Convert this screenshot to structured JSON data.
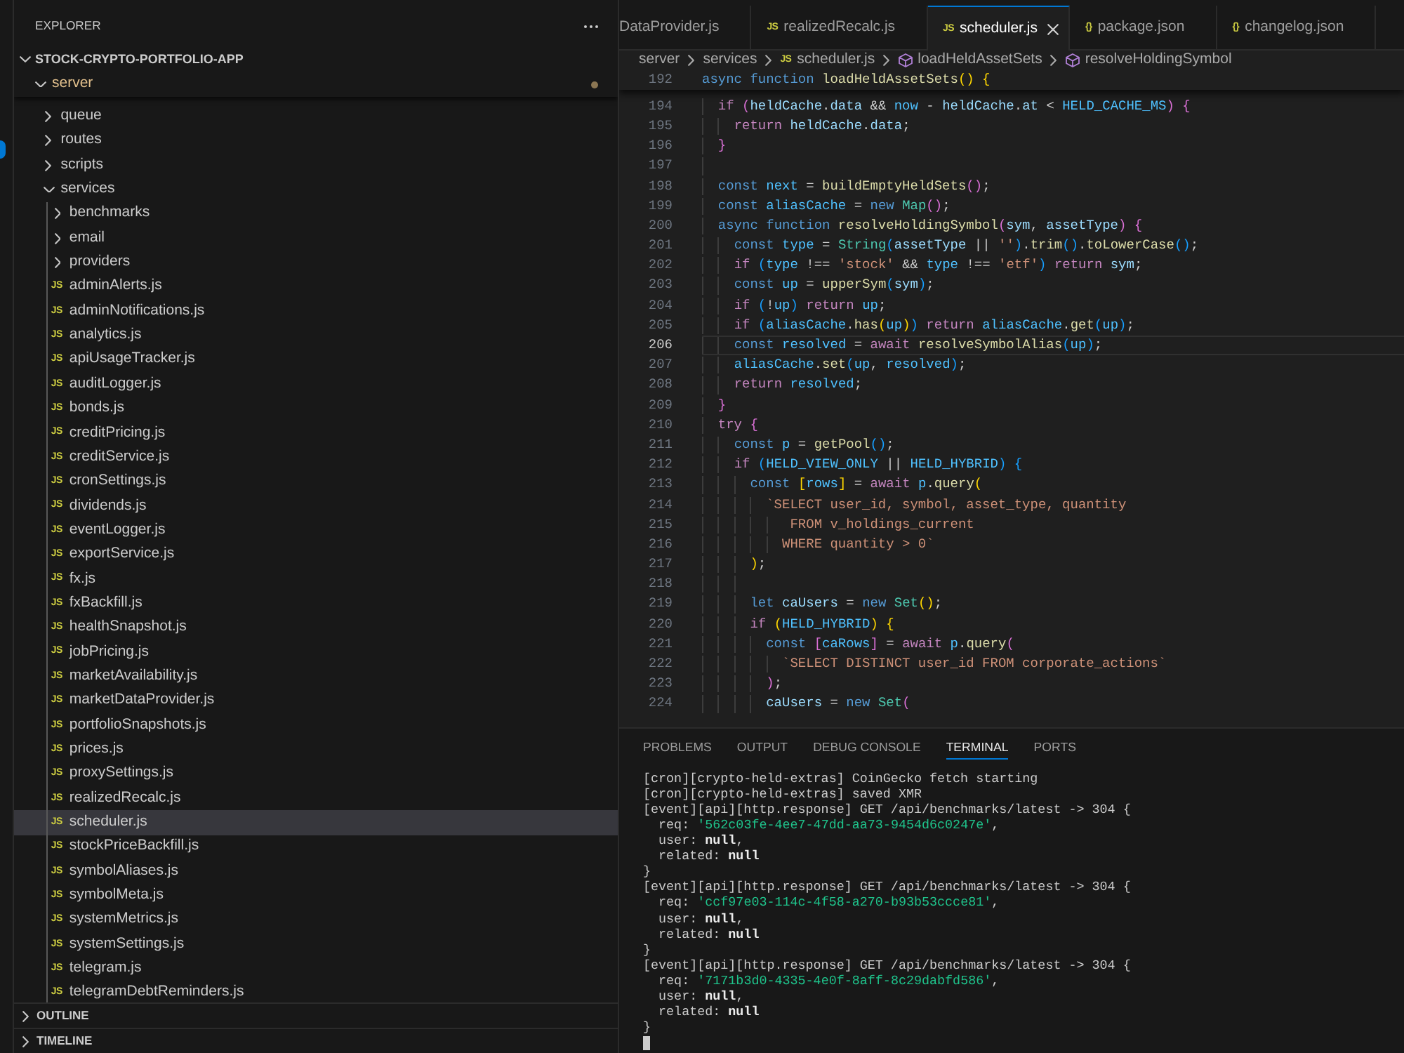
{
  "sidebar": {
    "title": "EXPLORER",
    "root": {
      "label": "STOCK-CRYPTO-PORTFOLIO-APP",
      "expanded": true,
      "children": [
        {
          "label": "server",
          "kind": "folder",
          "expanded": true,
          "modified": true,
          "selected": false,
          "children": [
            {
              "label": "queue",
              "kind": "folder",
              "expanded": false,
              "modified": false,
              "selected": false
            },
            {
              "label": "routes",
              "kind": "folder",
              "expanded": false,
              "modified": false,
              "selected": false
            },
            {
              "label": "scripts",
              "kind": "folder",
              "expanded": false,
              "modified": false,
              "selected": false
            },
            {
              "label": "services",
              "kind": "folder",
              "expanded": true,
              "modified": false,
              "selected": false,
              "children": [
                {
                  "label": "benchmarks",
                  "kind": "folder",
                  "expanded": false,
                  "modified": false,
                  "selected": false
                },
                {
                  "label": "email",
                  "kind": "folder",
                  "expanded": false,
                  "modified": false,
                  "selected": false
                },
                {
                  "label": "providers",
                  "kind": "folder",
                  "expanded": false,
                  "modified": false,
                  "selected": false
                },
                {
                  "label": "adminAlerts.js",
                  "kind": "file",
                  "icon": "JS",
                  "modified": false,
                  "selected": false
                },
                {
                  "label": "adminNotifications.js",
                  "kind": "file",
                  "icon": "JS",
                  "modified": false,
                  "selected": false
                },
                {
                  "label": "analytics.js",
                  "kind": "file",
                  "icon": "JS",
                  "modified": false,
                  "selected": false
                },
                {
                  "label": "apiUsageTracker.js",
                  "kind": "file",
                  "icon": "JS",
                  "modified": false,
                  "selected": false
                },
                {
                  "label": "auditLogger.js",
                  "kind": "file",
                  "icon": "JS",
                  "modified": false,
                  "selected": false
                },
                {
                  "label": "bonds.js",
                  "kind": "file",
                  "icon": "JS",
                  "modified": false,
                  "selected": false
                },
                {
                  "label": "creditPricing.js",
                  "kind": "file",
                  "icon": "JS",
                  "modified": false,
                  "selected": false
                },
                {
                  "label": "creditService.js",
                  "kind": "file",
                  "icon": "JS",
                  "modified": false,
                  "selected": false
                },
                {
                  "label": "cronSettings.js",
                  "kind": "file",
                  "icon": "JS",
                  "modified": false,
                  "selected": false
                },
                {
                  "label": "dividends.js",
                  "kind": "file",
                  "icon": "JS",
                  "modified": false,
                  "selected": false
                },
                {
                  "label": "eventLogger.js",
                  "kind": "file",
                  "icon": "JS",
                  "modified": false,
                  "selected": false
                },
                {
                  "label": "exportService.js",
                  "kind": "file",
                  "icon": "JS",
                  "modified": false,
                  "selected": false
                },
                {
                  "label": "fx.js",
                  "kind": "file",
                  "icon": "JS",
                  "modified": false,
                  "selected": false
                },
                {
                  "label": "fxBackfill.js",
                  "kind": "file",
                  "icon": "JS",
                  "modified": false,
                  "selected": false
                },
                {
                  "label": "healthSnapshot.js",
                  "kind": "file",
                  "icon": "JS",
                  "modified": false,
                  "selected": false
                },
                {
                  "label": "jobPricing.js",
                  "kind": "file",
                  "icon": "JS",
                  "modified": false,
                  "selected": false
                },
                {
                  "label": "marketAvailability.js",
                  "kind": "file",
                  "icon": "JS",
                  "modified": false,
                  "selected": false
                },
                {
                  "label": "marketDataProvider.js",
                  "kind": "file",
                  "icon": "JS",
                  "modified": false,
                  "selected": false
                },
                {
                  "label": "portfolioSnapshots.js",
                  "kind": "file",
                  "icon": "JS",
                  "modified": false,
                  "selected": false
                },
                {
                  "label": "prices.js",
                  "kind": "file",
                  "icon": "JS",
                  "modified": false,
                  "selected": false
                },
                {
                  "label": "proxySettings.js",
                  "kind": "file",
                  "icon": "JS",
                  "modified": false,
                  "selected": false
                },
                {
                  "label": "realizedRecalc.js",
                  "kind": "file",
                  "icon": "JS",
                  "modified": false,
                  "selected": false
                },
                {
                  "label": "scheduler.js",
                  "kind": "file",
                  "icon": "JS",
                  "modified": false,
                  "selected": true
                },
                {
                  "label": "stockPriceBackfill.js",
                  "kind": "file",
                  "icon": "JS",
                  "modified": false,
                  "selected": false
                },
                {
                  "label": "symbolAliases.js",
                  "kind": "file",
                  "icon": "JS",
                  "modified": false,
                  "selected": false
                },
                {
                  "label": "symbolMeta.js",
                  "kind": "file",
                  "icon": "JS",
                  "modified": false,
                  "selected": false
                },
                {
                  "label": "systemMetrics.js",
                  "kind": "file",
                  "icon": "JS",
                  "modified": false,
                  "selected": false
                },
                {
                  "label": "systemSettings.js",
                  "kind": "file",
                  "icon": "JS",
                  "modified": false,
                  "selected": false
                },
                {
                  "label": "telegram.js",
                  "kind": "file",
                  "icon": "JS",
                  "modified": false,
                  "selected": false
                },
                {
                  "label": "telegramDebtReminders.js",
                  "kind": "file",
                  "icon": "JS",
                  "modified": false,
                  "selected": false
                }
              ]
            }
          ]
        }
      ]
    },
    "sections": [
      {
        "label": "OUTLINE",
        "expanded": false
      },
      {
        "label": "TIMELINE",
        "expanded": false
      }
    ]
  },
  "editor": {
    "tabs": [
      {
        "label": "DataProvider.js",
        "selected": false
      },
      {
        "label": "realizedRecalc.js",
        "icon": "JS",
        "selected": false
      },
      {
        "label": "scheduler.js",
        "icon": "JS",
        "selected": true
      },
      {
        "label": "package.json",
        "icon": "{}",
        "selected": false
      },
      {
        "label": "changelog.json",
        "icon": "{}",
        "selected": false
      }
    ],
    "breadcrumb": [
      {
        "label": "server",
        "kind": "folder"
      },
      {
        "label": "services",
        "kind": "folder"
      },
      {
        "label": "scheduler.js",
        "kind": "file",
        "icon": "JS"
      },
      {
        "label": "loadHeldAssetSets",
        "kind": "symbol"
      },
      {
        "label": "resolveHoldingSymbol",
        "kind": "symbol"
      }
    ],
    "sticky_line": {
      "number": "192",
      "tokens": [
        {
          "kind": "keyword",
          "text": "async function "
        },
        {
          "kind": "function",
          "text": "loadHeldAssetSets"
        },
        {
          "kind": "bracket1",
          "text": "() {"
        }
      ]
    },
    "lines": [
      {
        "number": "194",
        "current": false,
        "tokens": [
          {
            "kind": "control",
            "text": "  if "
          },
          {
            "kind": "bracket2",
            "text": "("
          },
          {
            "kind": "variable",
            "text": "heldCache"
          },
          {
            "kind": "plain",
            "text": "."
          },
          {
            "kind": "variable",
            "text": "data"
          },
          {
            "kind": "plain",
            "text": " && "
          },
          {
            "kind": "constant",
            "text": "now"
          },
          {
            "kind": "plain",
            "text": " - "
          },
          {
            "kind": "variable",
            "text": "heldCache"
          },
          {
            "kind": "plain",
            "text": "."
          },
          {
            "kind": "variable",
            "text": "at"
          },
          {
            "kind": "plain",
            "text": " < "
          },
          {
            "kind": "constant",
            "text": "HELD_CACHE_MS"
          },
          {
            "kind": "bracket2",
            "text": ") {"
          }
        ]
      },
      {
        "number": "195",
        "current": false,
        "tokens": [
          {
            "kind": "control",
            "text": "    return "
          },
          {
            "kind": "variable",
            "text": "heldCache"
          },
          {
            "kind": "plain",
            "text": "."
          },
          {
            "kind": "variable",
            "text": "data"
          },
          {
            "kind": "plain",
            "text": ";"
          }
        ]
      },
      {
        "number": "196",
        "current": false,
        "tokens": [
          {
            "kind": "bracket2",
            "text": "  }"
          }
        ]
      },
      {
        "number": "197",
        "current": false
      },
      {
        "number": "198",
        "current": false,
        "tokens": [
          {
            "kind": "keyword",
            "text": "  const "
          },
          {
            "kind": "constant",
            "text": "next"
          },
          {
            "kind": "plain",
            "text": " = "
          },
          {
            "kind": "function",
            "text": "buildEmptyHeldSets"
          },
          {
            "kind": "bracket2",
            "text": "()"
          },
          {
            "kind": "plain",
            "text": ";"
          }
        ]
      },
      {
        "number": "199",
        "current": false,
        "tokens": [
          {
            "kind": "keyword",
            "text": "  const "
          },
          {
            "kind": "constant",
            "text": "aliasCache"
          },
          {
            "kind": "plain",
            "text": " = "
          },
          {
            "kind": "keyword",
            "text": "new "
          },
          {
            "kind": "class",
            "text": "Map"
          },
          {
            "kind": "bracket2",
            "text": "()"
          },
          {
            "kind": "plain",
            "text": ";"
          }
        ]
      },
      {
        "number": "200",
        "current": false,
        "tokens": [
          {
            "kind": "keyword",
            "text": "  async function "
          },
          {
            "kind": "function",
            "text": "resolveHoldingSymbol"
          },
          {
            "kind": "bracket2",
            "text": "("
          },
          {
            "kind": "variable",
            "text": "sym"
          },
          {
            "kind": "plain",
            "text": ", "
          },
          {
            "kind": "variable",
            "text": "assetType"
          },
          {
            "kind": "bracket2",
            "text": ") {"
          }
        ]
      },
      {
        "number": "201",
        "current": false,
        "tokens": [
          {
            "kind": "keyword",
            "text": "    const "
          },
          {
            "kind": "constant",
            "text": "type"
          },
          {
            "kind": "plain",
            "text": " = "
          },
          {
            "kind": "class",
            "text": "String"
          },
          {
            "kind": "bracket3",
            "text": "("
          },
          {
            "kind": "variable",
            "text": "assetType"
          },
          {
            "kind": "plain",
            "text": " || "
          },
          {
            "kind": "string",
            "text": "''"
          },
          {
            "kind": "bracket3",
            "text": ")"
          },
          {
            "kind": "plain",
            "text": "."
          },
          {
            "kind": "function",
            "text": "trim"
          },
          {
            "kind": "bracket3",
            "text": "()"
          },
          {
            "kind": "plain",
            "text": "."
          },
          {
            "kind": "function",
            "text": "toLowerCase"
          },
          {
            "kind": "bracket3",
            "text": "()"
          },
          {
            "kind": "plain",
            "text": ";"
          }
        ]
      },
      {
        "number": "202",
        "current": false,
        "tokens": [
          {
            "kind": "control",
            "text": "    if "
          },
          {
            "kind": "bracket3",
            "text": "("
          },
          {
            "kind": "constant",
            "text": "type"
          },
          {
            "kind": "plain",
            "text": " !== "
          },
          {
            "kind": "string",
            "text": "'stock'"
          },
          {
            "kind": "plain",
            "text": " && "
          },
          {
            "kind": "constant",
            "text": "type"
          },
          {
            "kind": "plain",
            "text": " !== "
          },
          {
            "kind": "string",
            "text": "'etf'"
          },
          {
            "kind": "bracket3",
            "text": ") "
          },
          {
            "kind": "control",
            "text": "return "
          },
          {
            "kind": "variable",
            "text": "sym"
          },
          {
            "kind": "plain",
            "text": ";"
          }
        ]
      },
      {
        "number": "203",
        "current": false,
        "tokens": [
          {
            "kind": "keyword",
            "text": "    const "
          },
          {
            "kind": "constant",
            "text": "up"
          },
          {
            "kind": "plain",
            "text": " = "
          },
          {
            "kind": "function",
            "text": "upperSym"
          },
          {
            "kind": "bracket3",
            "text": "("
          },
          {
            "kind": "variable",
            "text": "sym"
          },
          {
            "kind": "bracket3",
            "text": ")"
          },
          {
            "kind": "plain",
            "text": ";"
          }
        ]
      },
      {
        "number": "204",
        "current": false,
        "tokens": [
          {
            "kind": "control",
            "text": "    if "
          },
          {
            "kind": "bracket3",
            "text": "("
          },
          {
            "kind": "plain",
            "text": "!"
          },
          {
            "kind": "constant",
            "text": "up"
          },
          {
            "kind": "bracket3",
            "text": ") "
          },
          {
            "kind": "control",
            "text": "return "
          },
          {
            "kind": "constant",
            "text": "up"
          },
          {
            "kind": "plain",
            "text": ";"
          }
        ]
      },
      {
        "number": "205",
        "current": false,
        "tokens": [
          {
            "kind": "control",
            "text": "    if "
          },
          {
            "kind": "bracket3",
            "text": "("
          },
          {
            "kind": "constant",
            "text": "aliasCache"
          },
          {
            "kind": "plain",
            "text": "."
          },
          {
            "kind": "function",
            "text": "has"
          },
          {
            "kind": "bracket1",
            "text": "("
          },
          {
            "kind": "constant",
            "text": "up"
          },
          {
            "kind": "bracket1",
            "text": ")"
          },
          {
            "kind": "bracket3",
            "text": ") "
          },
          {
            "kind": "control",
            "text": "return "
          },
          {
            "kind": "constant",
            "text": "aliasCache"
          },
          {
            "kind": "plain",
            "text": "."
          },
          {
            "kind": "function",
            "text": "get"
          },
          {
            "kind": "bracket3",
            "text": "("
          },
          {
            "kind": "constant",
            "text": "up"
          },
          {
            "kind": "bracket3",
            "text": ")"
          },
          {
            "kind": "plain",
            "text": ";"
          }
        ]
      },
      {
        "number": "206",
        "current": true,
        "tokens": [
          {
            "kind": "keyword",
            "text": "    const "
          },
          {
            "kind": "constant",
            "text": "resolved"
          },
          {
            "kind": "plain",
            "text": " = "
          },
          {
            "kind": "control",
            "text": "await "
          },
          {
            "kind": "function",
            "text": "resolveSymbolAlias"
          },
          {
            "kind": "bracket3",
            "text": "("
          },
          {
            "kind": "constant",
            "text": "up"
          },
          {
            "kind": "bracket3",
            "text": ")"
          },
          {
            "kind": "plain",
            "text": ";"
          }
        ]
      },
      {
        "number": "207",
        "current": false,
        "tokens": [
          {
            "kind": "constant",
            "text": "    aliasCache"
          },
          {
            "kind": "plain",
            "text": "."
          },
          {
            "kind": "function",
            "text": "set"
          },
          {
            "kind": "bracket3",
            "text": "("
          },
          {
            "kind": "constant",
            "text": "up"
          },
          {
            "kind": "plain",
            "text": ", "
          },
          {
            "kind": "constant",
            "text": "resolved"
          },
          {
            "kind": "bracket3",
            "text": ")"
          },
          {
            "kind": "plain",
            "text": ";"
          }
        ]
      },
      {
        "number": "208",
        "current": false,
        "tokens": [
          {
            "kind": "control",
            "text": "    return "
          },
          {
            "kind": "constant",
            "text": "resolved"
          },
          {
            "kind": "plain",
            "text": ";"
          }
        ]
      },
      {
        "number": "209",
        "current": false,
        "tokens": [
          {
            "kind": "bracket2",
            "text": "  }"
          }
        ]
      },
      {
        "number": "210",
        "current": false,
        "tokens": [
          {
            "kind": "control",
            "text": "  try "
          },
          {
            "kind": "bracket2",
            "text": "{"
          }
        ]
      },
      {
        "number": "211",
        "current": false,
        "tokens": [
          {
            "kind": "keyword",
            "text": "    const "
          },
          {
            "kind": "constant",
            "text": "p"
          },
          {
            "kind": "plain",
            "text": " = "
          },
          {
            "kind": "function",
            "text": "getPool"
          },
          {
            "kind": "bracket3",
            "text": "()"
          },
          {
            "kind": "plain",
            "text": ";"
          }
        ]
      },
      {
        "number": "212",
        "current": false,
        "tokens": [
          {
            "kind": "control",
            "text": "    if "
          },
          {
            "kind": "bracket3",
            "text": "("
          },
          {
            "kind": "constant",
            "text": "HELD_VIEW_ONLY"
          },
          {
            "kind": "plain",
            "text": " || "
          },
          {
            "kind": "constant",
            "text": "HELD_HYBRID"
          },
          {
            "kind": "bracket3",
            "text": ") {"
          }
        ]
      },
      {
        "number": "213",
        "current": false,
        "tokens": [
          {
            "kind": "keyword",
            "text": "      const "
          },
          {
            "kind": "bracket1",
            "text": "["
          },
          {
            "kind": "constant",
            "text": "rows"
          },
          {
            "kind": "bracket1",
            "text": "]"
          },
          {
            "kind": "plain",
            "text": " = "
          },
          {
            "kind": "control",
            "text": "await "
          },
          {
            "kind": "constant",
            "text": "p"
          },
          {
            "kind": "plain",
            "text": "."
          },
          {
            "kind": "function",
            "text": "query"
          },
          {
            "kind": "bracket1",
            "text": "("
          }
        ]
      },
      {
        "number": "214",
        "current": false,
        "tokens": [
          {
            "kind": "string",
            "text": "        `SELECT user_id, symbol, asset_type, quantity"
          }
        ]
      },
      {
        "number": "215",
        "current": false,
        "tokens": [
          {
            "kind": "string",
            "text": "           FROM v_holdings_current"
          }
        ]
      },
      {
        "number": "216",
        "current": false,
        "tokens": [
          {
            "kind": "string",
            "text": "          WHERE quantity > 0`"
          }
        ]
      },
      {
        "number": "217",
        "current": false,
        "tokens": [
          {
            "kind": "bracket1",
            "text": "      )"
          },
          {
            "kind": "plain",
            "text": ";"
          }
        ]
      },
      {
        "number": "218",
        "current": false
      },
      {
        "number": "219",
        "current": false,
        "tokens": [
          {
            "kind": "keyword",
            "text": "      let "
          },
          {
            "kind": "variable",
            "text": "caUsers"
          },
          {
            "kind": "plain",
            "text": " = "
          },
          {
            "kind": "keyword",
            "text": "new "
          },
          {
            "kind": "class",
            "text": "Set"
          },
          {
            "kind": "bracket1",
            "text": "()"
          },
          {
            "kind": "plain",
            "text": ";"
          }
        ]
      },
      {
        "number": "220",
        "current": false,
        "tokens": [
          {
            "kind": "control",
            "text": "      if "
          },
          {
            "kind": "bracket1",
            "text": "("
          },
          {
            "kind": "constant",
            "text": "HELD_HYBRID"
          },
          {
            "kind": "bracket1",
            "text": ") {"
          }
        ]
      },
      {
        "number": "221",
        "current": false,
        "tokens": [
          {
            "kind": "keyword",
            "text": "        const "
          },
          {
            "kind": "bracket2",
            "text": "["
          },
          {
            "kind": "constant",
            "text": "caRows"
          },
          {
            "kind": "bracket2",
            "text": "]"
          },
          {
            "kind": "plain",
            "text": " = "
          },
          {
            "kind": "control",
            "text": "await "
          },
          {
            "kind": "constant",
            "text": "p"
          },
          {
            "kind": "plain",
            "text": "."
          },
          {
            "kind": "function",
            "text": "query"
          },
          {
            "kind": "bracket2",
            "text": "("
          }
        ]
      },
      {
        "number": "222",
        "current": false,
        "tokens": [
          {
            "kind": "string",
            "text": "          `SELECT DISTINCT user_id FROM corporate_actions`"
          }
        ]
      },
      {
        "number": "223",
        "current": false,
        "tokens": [
          {
            "kind": "bracket2",
            "text": "        )"
          },
          {
            "kind": "plain",
            "text": ";"
          }
        ]
      },
      {
        "number": "224",
        "current": false,
        "tokens": [
          {
            "kind": "variable",
            "text": "        caUsers"
          },
          {
            "kind": "plain",
            "text": " = "
          },
          {
            "kind": "keyword",
            "text": "new "
          },
          {
            "kind": "class",
            "text": "Set"
          },
          {
            "kind": "bracket2",
            "text": "("
          }
        ]
      }
    ]
  },
  "panel": {
    "tabs": [
      {
        "label": "PROBLEMS",
        "selected": false
      },
      {
        "label": "OUTPUT",
        "selected": false
      },
      {
        "label": "DEBUG CONSOLE",
        "selected": false
      },
      {
        "label": "TERMINAL",
        "selected": true
      },
      {
        "label": "PORTS",
        "selected": false
      }
    ],
    "terminal": {
      "cursor": true,
      "lines": [
        {
          "tokens": [
            {
              "kind": "plain",
              "text": "[cron][crypto-held-extras] CoinGecko fetch starting"
            }
          ]
        },
        {
          "tokens": [
            {
              "kind": "plain",
              "text": "[cron][crypto-held-extras] saved XMR"
            }
          ]
        },
        {
          "tokens": [
            {
              "kind": "plain",
              "text": "[event][api][http.response] GET /api/benchmarks/latest -> 304 {"
            }
          ]
        },
        {
          "tokens": [
            {
              "kind": "plain",
              "text": "  req: "
            },
            {
              "kind": "string",
              "text": "'562c03fe-4ee7-47dd-aa73-9454d6c0247e'"
            },
            {
              "kind": "plain",
              "text": ","
            }
          ]
        },
        {
          "tokens": [
            {
              "kind": "plain",
              "text": "  user: "
            },
            {
              "kind": "bold",
              "text": "null"
            },
            {
              "kind": "plain",
              "text": ","
            }
          ]
        },
        {
          "tokens": [
            {
              "kind": "plain",
              "text": "  related: "
            },
            {
              "kind": "bold",
              "text": "null"
            }
          ]
        },
        {
          "tokens": [
            {
              "kind": "plain",
              "text": "}"
            }
          ]
        },
        {
          "tokens": [
            {
              "kind": "plain",
              "text": "[event][api][http.response] GET /api/benchmarks/latest -> 304 {"
            }
          ]
        },
        {
          "tokens": [
            {
              "kind": "plain",
              "text": "  req: "
            },
            {
              "kind": "string",
              "text": "'ccf97e03-114c-4f58-a270-b93b53ccce81'"
            },
            {
              "kind": "plain",
              "text": ","
            }
          ]
        },
        {
          "tokens": [
            {
              "kind": "plain",
              "text": "  user: "
            },
            {
              "kind": "bold",
              "text": "null"
            },
            {
              "kind": "plain",
              "text": ","
            }
          ]
        },
        {
          "tokens": [
            {
              "kind": "plain",
              "text": "  related: "
            },
            {
              "kind": "bold",
              "text": "null"
            }
          ]
        },
        {
          "tokens": [
            {
              "kind": "plain",
              "text": "}"
            }
          ]
        },
        {
          "tokens": [
            {
              "kind": "plain",
              "text": "[event][api][http.response] GET /api/benchmarks/latest -> 304 {"
            }
          ]
        },
        {
          "tokens": [
            {
              "kind": "plain",
              "text": "  req: "
            },
            {
              "kind": "string",
              "text": "'7171b3d0-4335-4e0f-8aff-8c29dabfd586'"
            },
            {
              "kind": "plain",
              "text": ","
            }
          ]
        },
        {
          "tokens": [
            {
              "kind": "plain",
              "text": "  user: "
            },
            {
              "kind": "bold",
              "text": "null"
            },
            {
              "kind": "plain",
              "text": ","
            }
          ]
        },
        {
          "tokens": [
            {
              "kind": "plain",
              "text": "  related: "
            },
            {
              "kind": "bold",
              "text": "null"
            }
          ]
        },
        {
          "tokens": [
            {
              "kind": "plain",
              "text": "}"
            }
          ]
        }
      ]
    }
  }
}
